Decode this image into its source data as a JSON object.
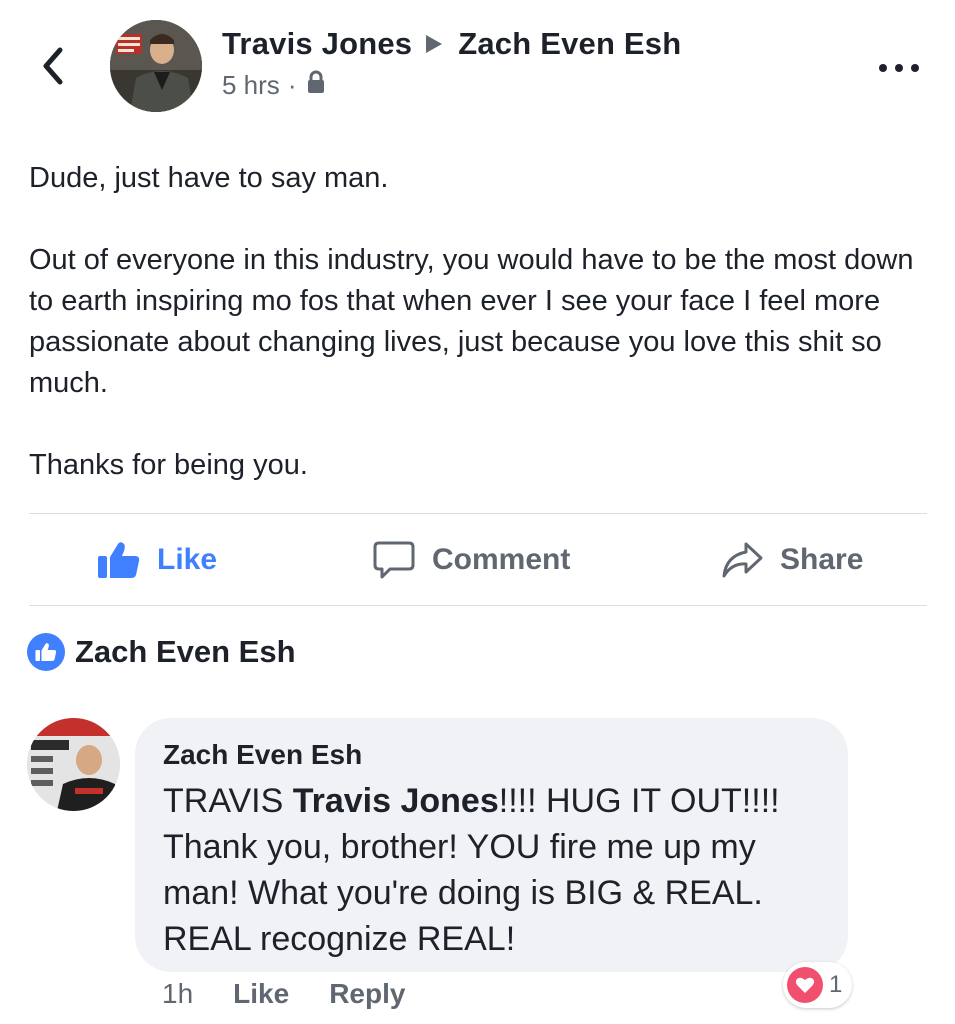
{
  "header": {
    "author": "Travis Jones",
    "target": "Zach Even Esh",
    "timestamp": "5 hrs",
    "separator": "·",
    "privacy_icon": "lock-icon",
    "back_icon": "chevron-left-icon",
    "more_icon": "more-dots-icon"
  },
  "post": {
    "paragraphs": [
      "Dude, just have to say man.",
      "Out of everyone in this industry, you would have to be the most down to earth inspiring mo fos that when ever I see your face I feel more passionate about changing lives, just because you love this shit so much.",
      "Thanks for being you."
    ]
  },
  "actions": {
    "like_label": "Like",
    "comment_label": "Comment",
    "share_label": "Share",
    "like_color": "#4080ff"
  },
  "likes": {
    "names": "Zach Even Esh"
  },
  "comment": {
    "author": "Zach Even Esh",
    "text_before": "TRAVIS ",
    "tag": "Travis Jones",
    "text_after": "!!!! HUG IT OUT!!!! Thank you, brother! YOU fire me up my man! What you're doing is BIG & REAL. REAL recognize REAL!",
    "time": "1h",
    "like_label": "Like",
    "reply_label": "Reply",
    "reaction_count": "1",
    "reaction_color": "#f0506e"
  }
}
